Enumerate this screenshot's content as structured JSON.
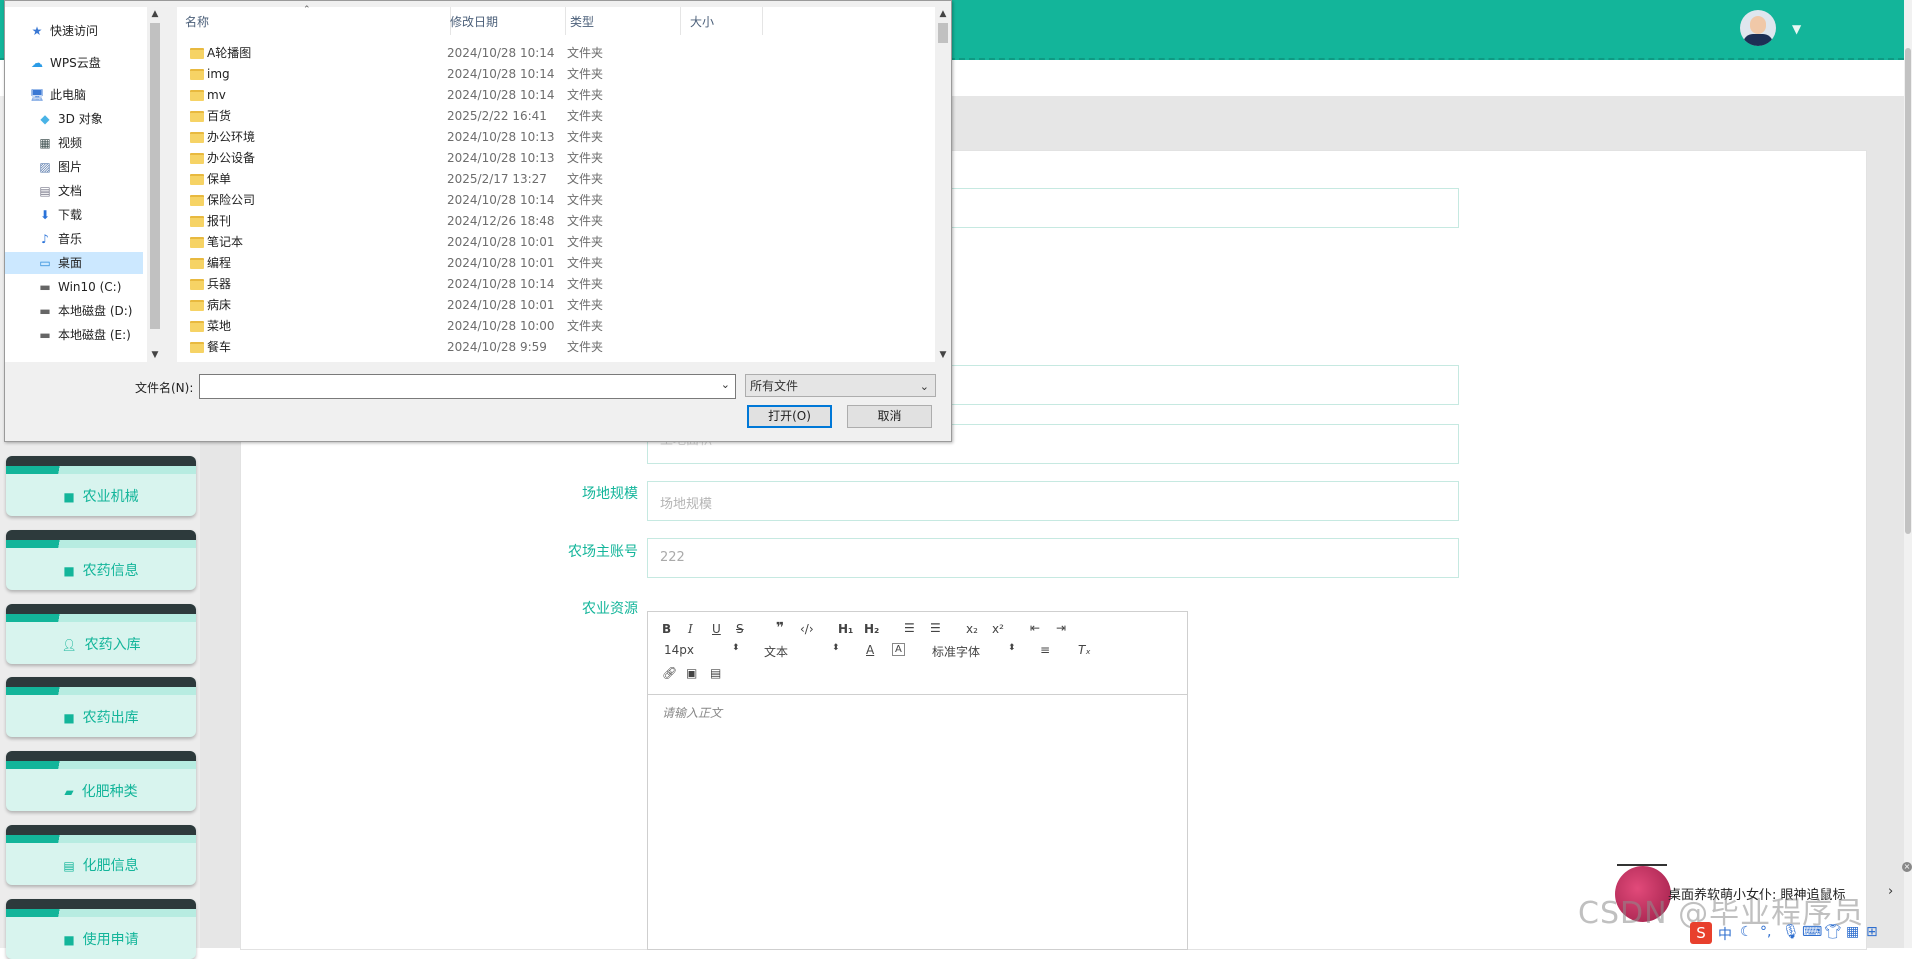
{
  "app": {
    "topbar_color": "#13b59a",
    "avatar_icon": "user-avatar",
    "sidebar": [
      {
        "label": "农业机械",
        "icon": "grid-icon"
      },
      {
        "label": "农药信息",
        "icon": "grid-icon"
      },
      {
        "label": "农药入库",
        "icon": "user-icon"
      },
      {
        "label": "农药出库",
        "icon": "grid-icon"
      },
      {
        "label": "化肥种类",
        "icon": "ticket-icon"
      },
      {
        "label": "化肥信息",
        "icon": "clipboard-icon"
      },
      {
        "label": "使用申请",
        "icon": "grid-icon"
      }
    ],
    "form": {
      "partial_placeholder": "土地面积",
      "site_scale_label": "场地规模",
      "site_scale_placeholder": "场地规模",
      "farm_account_label": "农场主账号",
      "farm_account_value": "222",
      "resources_label": "农业资源"
    },
    "editor": {
      "font_size": "14px",
      "block_type": "文本",
      "font_family": "标准字体",
      "placeholder": "请输入正文"
    },
    "widget": {
      "notice": "桌面养软萌小女仆: 眼神追鼠标",
      "watermark": "CSDN @毕业程序员",
      "ime_label": "中"
    }
  },
  "dialog": {
    "nav": [
      {
        "label": "快速访问",
        "icon": "star-icon"
      },
      {
        "label": "WPS云盘",
        "icon": "cloud-icon"
      },
      {
        "label": "此电脑",
        "icon": "computer-icon"
      },
      {
        "label": "3D 对象",
        "icon": "cube-icon"
      },
      {
        "label": "视频",
        "icon": "video-icon"
      },
      {
        "label": "图片",
        "icon": "picture-icon"
      },
      {
        "label": "文档",
        "icon": "document-icon"
      },
      {
        "label": "下载",
        "icon": "download-icon"
      },
      {
        "label": "音乐",
        "icon": "music-icon"
      },
      {
        "label": "桌面",
        "icon": "desktop-icon",
        "selected": true
      },
      {
        "label": "Win10 (C:)",
        "icon": "drive-icon"
      },
      {
        "label": "本地磁盘 (D:)",
        "icon": "drive-icon"
      },
      {
        "label": "本地磁盘 (E:)",
        "icon": "drive-icon"
      }
    ],
    "columns": {
      "name": "名称",
      "modified": "修改日期",
      "type": "类型",
      "size": "大小"
    },
    "files": [
      {
        "name": "A轮播图",
        "date": "2024/10/28 10:14",
        "type": "文件夹"
      },
      {
        "name": "img",
        "date": "2024/10/28 10:14",
        "type": "文件夹"
      },
      {
        "name": "mv",
        "date": "2024/10/28 10:14",
        "type": "文件夹"
      },
      {
        "name": "百货",
        "date": "2025/2/22 16:41",
        "type": "文件夹"
      },
      {
        "name": "办公环境",
        "date": "2024/10/28 10:13",
        "type": "文件夹"
      },
      {
        "name": "办公设备",
        "date": "2024/10/28 10:13",
        "type": "文件夹"
      },
      {
        "name": "保单",
        "date": "2025/2/17 13:27",
        "type": "文件夹"
      },
      {
        "name": "保险公司",
        "date": "2024/10/28 10:14",
        "type": "文件夹"
      },
      {
        "name": "报刊",
        "date": "2024/12/26 18:48",
        "type": "文件夹"
      },
      {
        "name": "笔记本",
        "date": "2024/10/28 10:01",
        "type": "文件夹"
      },
      {
        "name": "编程",
        "date": "2024/10/28 10:01",
        "type": "文件夹"
      },
      {
        "name": "兵器",
        "date": "2024/10/28 10:14",
        "type": "文件夹"
      },
      {
        "name": "病床",
        "date": "2024/10/28 10:01",
        "type": "文件夹"
      },
      {
        "name": "菜地",
        "date": "2024/10/28 10:00",
        "type": "文件夹"
      },
      {
        "name": "餐车",
        "date": "2024/10/28 9:59",
        "type": "文件夹"
      }
    ],
    "filename_label": "文件名(N):",
    "filename_value": "",
    "filetype": "所有文件",
    "open_button": "打开(O)",
    "cancel_button": "取消"
  }
}
